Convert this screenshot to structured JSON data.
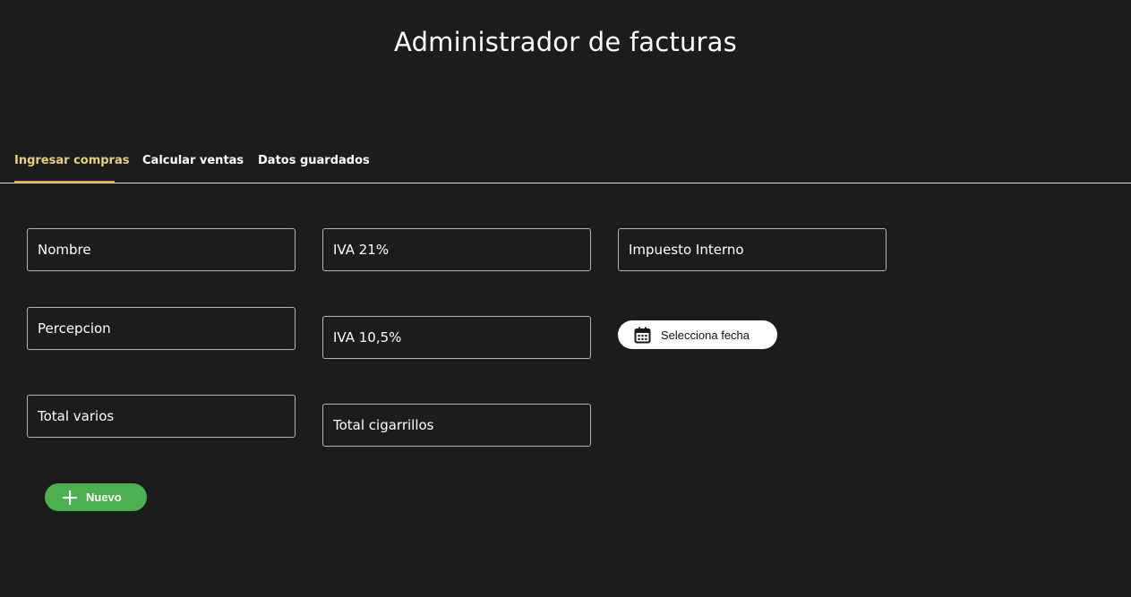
{
  "app": {
    "title": "Administrador de facturas"
  },
  "tabs": [
    {
      "label": "Ingresar compras",
      "active": true
    },
    {
      "label": "Calcular ventas",
      "active": false
    },
    {
      "label": "Datos guardados",
      "active": false
    }
  ],
  "form": {
    "nombre": {
      "placeholder": "Nombre",
      "value": ""
    },
    "percepcion": {
      "placeholder": "Percepcion",
      "value": ""
    },
    "total_varios": {
      "placeholder": "Total varios",
      "value": ""
    },
    "iva_21": {
      "placeholder": "IVA 21%",
      "value": ""
    },
    "iva_105": {
      "placeholder": "IVA 10,5%",
      "value": ""
    },
    "total_cigarrillos": {
      "placeholder": "Total cigarrillos",
      "value": ""
    },
    "impuesto_interno": {
      "placeholder": "Impuesto Interno",
      "value": ""
    }
  },
  "date_button": {
    "label": "Selecciona fecha",
    "icon": "calendar-icon"
  },
  "new_button": {
    "label": "Nuevo",
    "icon": "plus-icon"
  },
  "colors": {
    "background": "#1c1c1c",
    "active_tab_text": "#e7d27a",
    "active_tab_indicator": "#e8a43a",
    "new_button": "#4caf50",
    "date_button": "#ffffff"
  }
}
